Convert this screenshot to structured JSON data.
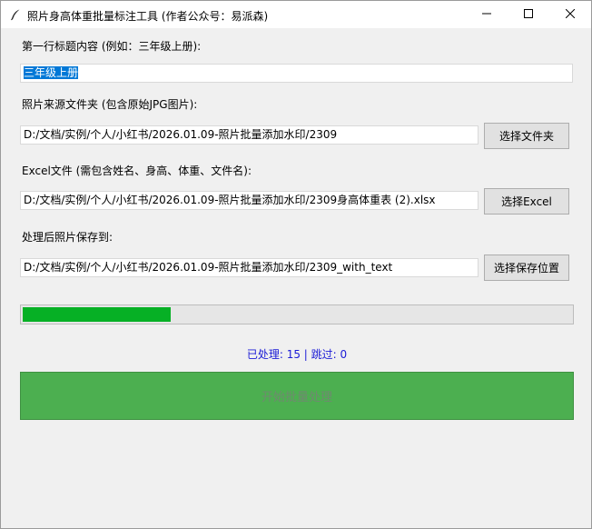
{
  "window": {
    "title": "照片身高体重批量标注工具 (作者公众号：易派森)",
    "app_icon": "feather-icon",
    "controls": [
      "minimize-icon",
      "maximize-icon",
      "close-icon"
    ]
  },
  "form": {
    "title_label": "第一行标题内容 (例如：三年级上册):",
    "title_value": "三年级上册",
    "source_label": "照片来源文件夹 (包含原始JPG图片):",
    "source_value": "D:/文档/实例/个人/小红书/2026.01.09-照片批量添加水印/2309",
    "source_button": "选择文件夹",
    "excel_label": "Excel文件 (需包含姓名、身高、体重、文件名):",
    "excel_value": "D:/文档/实例/个人/小红书/2026.01.09-照片批量添加水印/2309身高体重表 (2).xlsx",
    "excel_button": "选择Excel",
    "output_label": "处理后照片保存到:",
    "output_value": "D:/文档/实例/个人/小红书/2026.01.09-照片批量添加水印/2309_with_text",
    "output_button": "选择保存位置"
  },
  "progress": {
    "fraction": 0.27,
    "color": "#06b025"
  },
  "status": {
    "text": "已处理: 15 | 跳过: 0",
    "color": "#1b1bd6"
  },
  "start_button": {
    "label": "开始批量处理",
    "color": "#4caf50"
  }
}
